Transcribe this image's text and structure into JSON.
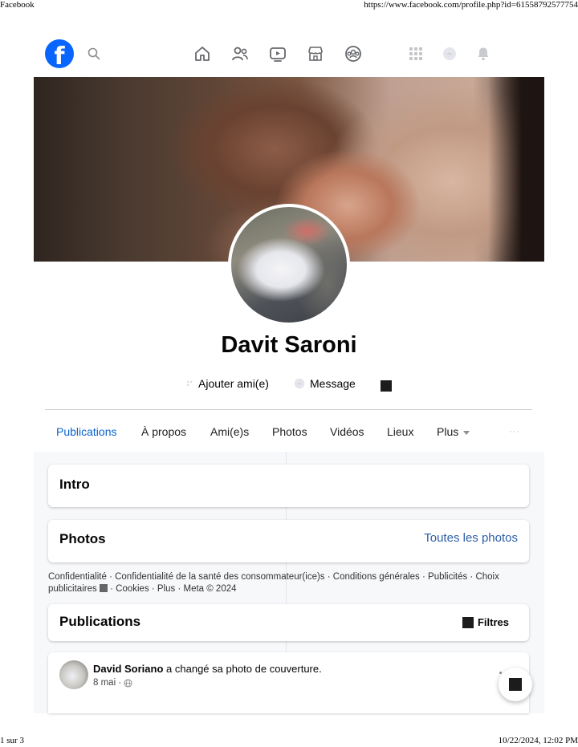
{
  "print": {
    "title": "Facebook",
    "url": "https://www.facebook.com/profile.php?id=61558792577754",
    "page": "1 sur 3",
    "datetime": "10/22/2024, 12:02 PM"
  },
  "nav": {
    "logo": "f",
    "icons": [
      "home-icon",
      "friends-icon",
      "watch-icon",
      "marketplace-icon",
      "groups-icon"
    ],
    "right_icons": [
      "menu-grid-icon",
      "messenger-icon",
      "notifications-icon"
    ]
  },
  "profile": {
    "name": "Davit Saroni",
    "add_friend": "Ajouter ami(e)",
    "message": "Message"
  },
  "tabs": {
    "publications": "Publications",
    "about": "À propos",
    "friends": "Ami(e)s",
    "photos": "Photos",
    "videos": "Vidéos",
    "places": "Lieux",
    "more": "Plus",
    "dots": "···"
  },
  "intro": {
    "title": "Intro"
  },
  "photos": {
    "title": "Photos",
    "link": "Toutes les photos"
  },
  "footer": {
    "line1": "Confidentialité · Confidentialité de la santé des consommateur(ice)s · Conditions générales · Publicités · Choix",
    "line2a": "publicitaires ",
    "line2b": " · Cookies · Plus · Meta © 2024"
  },
  "publications": {
    "title": "Publications",
    "filters": "Filtres"
  },
  "post": {
    "author": "David Soriano",
    "action": " a changé sa photo de couverture.",
    "date": "8 mai ·"
  },
  "colors": {
    "brand": "#0866ff",
    "active_tab": "#0a62d0",
    "link": "#2d5ea8"
  }
}
